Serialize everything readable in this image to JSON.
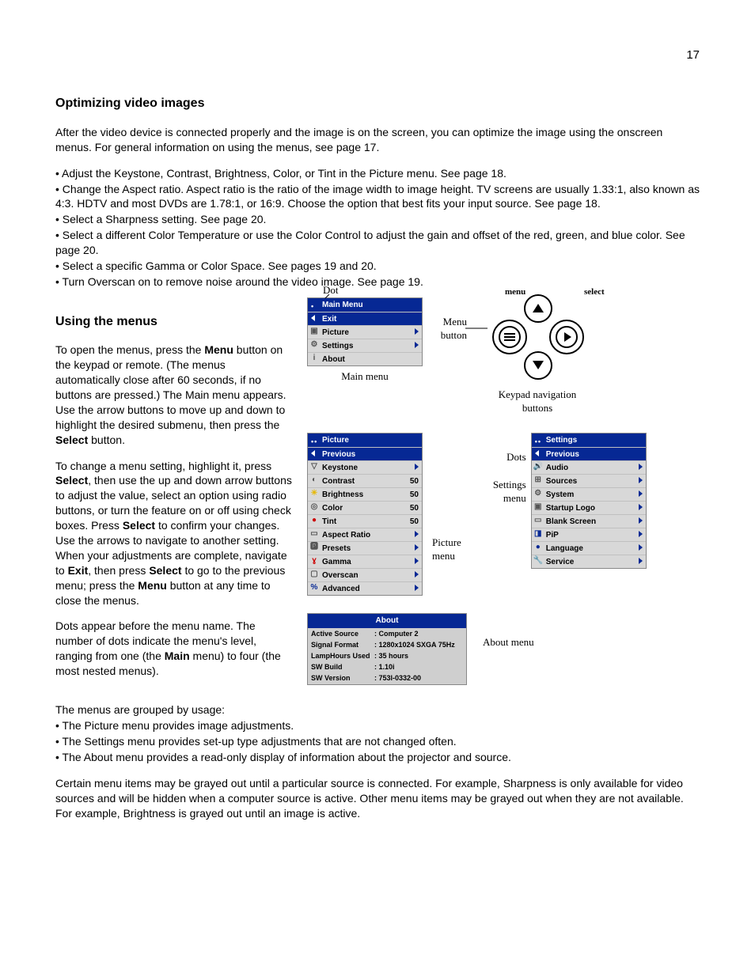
{
  "page_number": "17",
  "h1": "Optimizing video images",
  "intro": "After the video device is connected properly and the image is on the screen, you can optimize the image using the onscreen menus. For general information on using the menus, see page 17.",
  "opt_bullets": [
    "• Adjust the Keystone, Contrast, Brightness, Color, or Tint in the Picture menu. See page 18.",
    "• Change the Aspect ratio. Aspect ratio is the ratio of the image width to image height. TV screens are usually 1.33:1, also known as 4:3. HDTV and most DVDs are 1.78:1, or 16:9. Choose the option that best fits your input source. See page 18.",
    "• Select a Sharpness setting. See page 20.",
    "• Select a different Color Temperature or use the Color Control to adjust the gain and offset of the red, green, and blue color. See page 20.",
    "• Select a specific Gamma or Color Space. See pages 19 and 20.",
    "• Turn Overscan on to remove noise around the video image. See page 19."
  ],
  "h2": "Using the menus",
  "para1_parts": [
    "To open the menus, press the ",
    "Menu",
    " button on the keypad or remote. (The menus automatically close after 60 seconds, if no buttons are pressed.) The Main menu appears. Use the arrow buttons to move up and down to highlight the desired submenu, then press the ",
    "Select",
    " button."
  ],
  "para2_parts": [
    "To change a menu setting, highlight it, press ",
    "Select",
    ", then use the up and down arrow buttons to adjust the value, select an option using radio buttons, or turn the feature on or off using check boxes. Press ",
    "Select",
    " to confirm your changes. Use the arrows to navigate to another setting. When your adjustments are complete, navigate to ",
    "Exit",
    ", then press ",
    "Select",
    " to go to the previous menu; press the ",
    "Menu",
    " button at any time to close the menus."
  ],
  "para3_parts": [
    "Dots appear before the menu name. The number of dots indicate the menu's level, ranging from one (the ",
    "Main",
    " menu) to four (the most nested menus)."
  ],
  "grouped_intro": "The menus are grouped by usage:",
  "grouped_bullets": [
    "• The Picture menu provides image adjustments.",
    "• The Settings menu provides set-up type adjustments that are not changed often.",
    "• The About menu provides a read-only display of information about the projector and source."
  ],
  "final_para": "Certain menu items may be grayed out until a particular source is connected. For example, Sharpness is only available for video sources and will be hidden when a computer source is active. Other menu items may be grayed out when they are not available. For example, Brightness is grayed out until an image is active.",
  "fig_labels": {
    "dot": "Dot",
    "main_menu_caption": "Main menu",
    "menu_button": "Menu\nbutton",
    "menu_txt": "menu",
    "select_txt": "select",
    "keypad_caption": "Keypad navigation\nbuttons",
    "dots": "Dots",
    "settings_menu": "Settings\nmenu",
    "picture_menu": "Picture\nmenu",
    "about_menu": "About menu"
  },
  "main_menu": {
    "title": "Main Menu",
    "rows": [
      {
        "label": "Exit",
        "prev": true
      },
      {
        "label": "Picture",
        "arrow": true,
        "icon": "▣"
      },
      {
        "label": "Settings",
        "arrow": true,
        "icon": "⚙"
      },
      {
        "label": "About",
        "icon": "i"
      }
    ]
  },
  "picture_menu": {
    "title": "Picture",
    "rows": [
      {
        "label": "Previous",
        "prev": true
      },
      {
        "label": "Keystone",
        "arrow": true,
        "icon": "▽"
      },
      {
        "label": "Contrast",
        "val": "50",
        "icon": "◐"
      },
      {
        "label": "Brightness",
        "val": "50",
        "icon": "☀"
      },
      {
        "label": "Color",
        "val": "50",
        "icon": "◎"
      },
      {
        "label": "Tint",
        "val": "50",
        "icon": "●"
      },
      {
        "label": "Aspect Ratio",
        "arrow": true,
        "icon": "▭"
      },
      {
        "label": "Presets",
        "arrow": true,
        "icon": "🅿"
      },
      {
        "label": "Gamma",
        "arrow": true,
        "icon": "ɣ"
      },
      {
        "label": "Overscan",
        "arrow": true,
        "icon": "▢"
      },
      {
        "label": "Advanced",
        "arrow": true,
        "icon": "%"
      }
    ]
  },
  "settings_menu_osd": {
    "title": "Settings",
    "rows": [
      {
        "label": "Previous",
        "prev": true
      },
      {
        "label": "Audio",
        "arrow": true,
        "icon": "🔊"
      },
      {
        "label": "Sources",
        "arrow": true,
        "icon": "⊞"
      },
      {
        "label": "System",
        "arrow": true,
        "icon": "⚙"
      },
      {
        "label": "Startup Logo",
        "arrow": true,
        "icon": "▣"
      },
      {
        "label": "Blank Screen",
        "arrow": true,
        "icon": "▭"
      },
      {
        "label": "PiP",
        "arrow": true,
        "icon": "◨"
      },
      {
        "label": "Language",
        "arrow": true,
        "icon": "●"
      },
      {
        "label": "Service",
        "arrow": true,
        "icon": "🔧"
      }
    ]
  },
  "about_box": {
    "title": "About",
    "rows": [
      {
        "k": "Active Source",
        "v": ": Computer 2"
      },
      {
        "k": "Signal Format",
        "v": ": 1280x1024 SXGA   75Hz"
      },
      {
        "k": "LampHours Used",
        "v": ": 35 hours"
      },
      {
        "k": "SW Build",
        "v": ": 1.10i"
      },
      {
        "k": "SW Version",
        "v": ": 753l-0332-00"
      }
    ]
  }
}
